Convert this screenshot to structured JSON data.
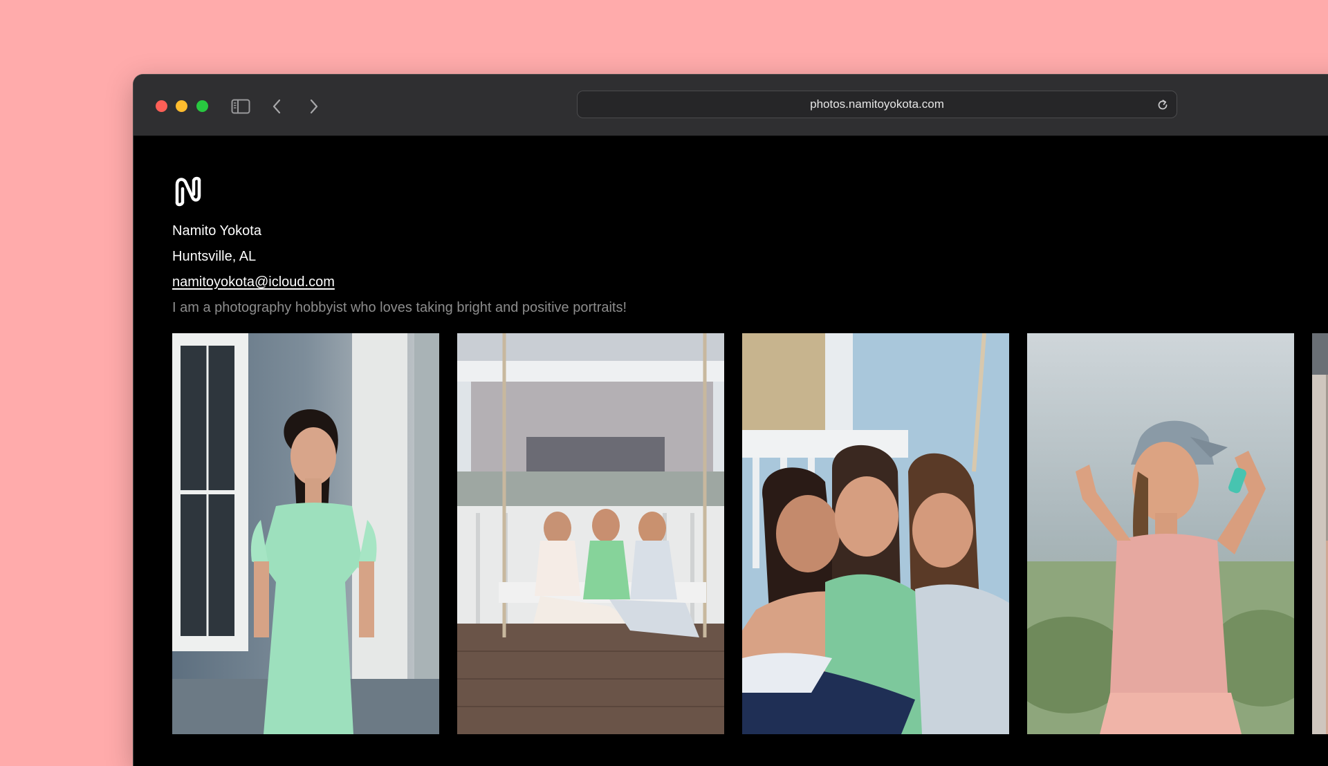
{
  "browser": {
    "url": "photos.namitoyokota.com",
    "icons": {
      "sidebar": "sidebar-icon",
      "back": "chevron-left-icon",
      "forward": "chevron-right-icon",
      "reload": "reload-icon"
    }
  },
  "profile": {
    "logo": "N-logo",
    "name": "Namito Yokota",
    "location": "Huntsville, AL",
    "email": "namitoyokota@icloud.com",
    "bio": "I am a photography hobbyist who loves taking bright and positive portraits!"
  },
  "gallery": {
    "photos": [
      "portrait-woman-mint-dress",
      "three-women-porch-swing",
      "three-women-closeup",
      "woman-cap-pink-top",
      "partial-photo"
    ]
  },
  "colors": {
    "background": "#ffabab",
    "window": "#000000",
    "titlebar": "#2f2f31"
  }
}
